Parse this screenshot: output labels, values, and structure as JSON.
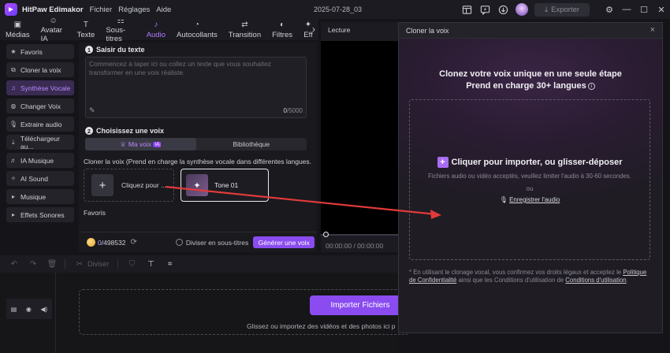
{
  "app": {
    "title": "HitPaw Edimakor",
    "menu": [
      "Fichier",
      "Réglages",
      "Aide"
    ],
    "project_name": "2025-07-28_03",
    "export_label": "Exporter",
    "accent": "#8a4cf0"
  },
  "tabs": [
    {
      "label": "Médias",
      "icon": "media-icon"
    },
    {
      "label": "Avatar IA",
      "icon": "avatar-icon"
    },
    {
      "label": "Texte",
      "icon": "text-icon"
    },
    {
      "label": "Sous-titres",
      "icon": "subtitles-icon"
    },
    {
      "label": "Audio",
      "icon": "music-note-icon",
      "active": true
    },
    {
      "label": "Autocollants",
      "icon": "sticker-icon"
    },
    {
      "label": "Transition",
      "icon": "transition-icon"
    },
    {
      "label": "Filtres",
      "icon": "filter-icon"
    },
    {
      "label": "Eff",
      "icon": "effects-icon"
    }
  ],
  "sidebar": {
    "items": [
      {
        "label": "Favoris",
        "icon": "star-icon"
      },
      {
        "label": "Cloner la voix",
        "icon": "clone-icon"
      },
      {
        "label": "Synthèse Vocale",
        "icon": "tts-icon",
        "active": true
      },
      {
        "label": "Changer Voix",
        "icon": "voice-change-icon"
      },
      {
        "label": "Extraire audio",
        "icon": "mic-icon"
      },
      {
        "label": "Téléchargeur au...",
        "icon": "download-icon"
      },
      {
        "label": "IA Musique",
        "icon": "ai-music-icon"
      },
      {
        "label": "AI Sound",
        "icon": "ai-sound-icon"
      },
      {
        "label": "Musique",
        "icon": "triangle-right-icon"
      },
      {
        "label": "Effets Sonores",
        "icon": "triangle-right-icon"
      }
    ]
  },
  "tts": {
    "step1_num": "1",
    "step1_title": "Saisir du texte",
    "placeholder": "Commencez à taper ici ou collez un texte que vous souhaitez transformer en une voix réaliste.",
    "count_used": "0",
    "count_max": "/5000",
    "step2_num": "2",
    "step2_title": "Choisissez une voix",
    "seg_my_voice": "Ma voix",
    "seg_badge": "IA",
    "seg_library": "Bibliothèque",
    "clone_desc": "Cloner la voix (Prend en charge la synthèse vocale dans différentes langues.",
    "add_card_label": "Cliquez pour ...",
    "tone_label": "Tone 01",
    "favorites_label": "Favoris",
    "credits_used": "0",
    "credits_total": "/498532",
    "split_subtitles_label": "Diviser en sous-titres",
    "generate_label": "Générer une voix"
  },
  "preview": {
    "title": "Lecture",
    "timecode": "00:00:00 / 00:00:00"
  },
  "timeline": {
    "split_label": "Diviser",
    "import_label": "Importer Fichiers",
    "drop_hint": "Glissez ou importez des vidéos et des photos ici p"
  },
  "dialog": {
    "title": "Cloner la voix",
    "headline1": "Clonez votre voix unique en une seule étape",
    "headline2": "Prend en charge 30+ langues",
    "import_label": "Cliquer pour importer, ou glisser-déposer",
    "note": "Fichiers audio ou vidéo acceptés, veuillez limiter l'audio à 30-60 secondes.",
    "or_label": "ou",
    "record_label": "Enregistrer l'audio",
    "legal_prefix": "* En utilisant le clonage vocal, vous confirmez vos droits légaux et acceptez le",
    "legal_privacy": "Politique de Confidentialité",
    "legal_middle": "ainsi que les Conditions d'utilisation de",
    "legal_terms": "Conditions d'utilisation",
    "legal_end": "."
  }
}
